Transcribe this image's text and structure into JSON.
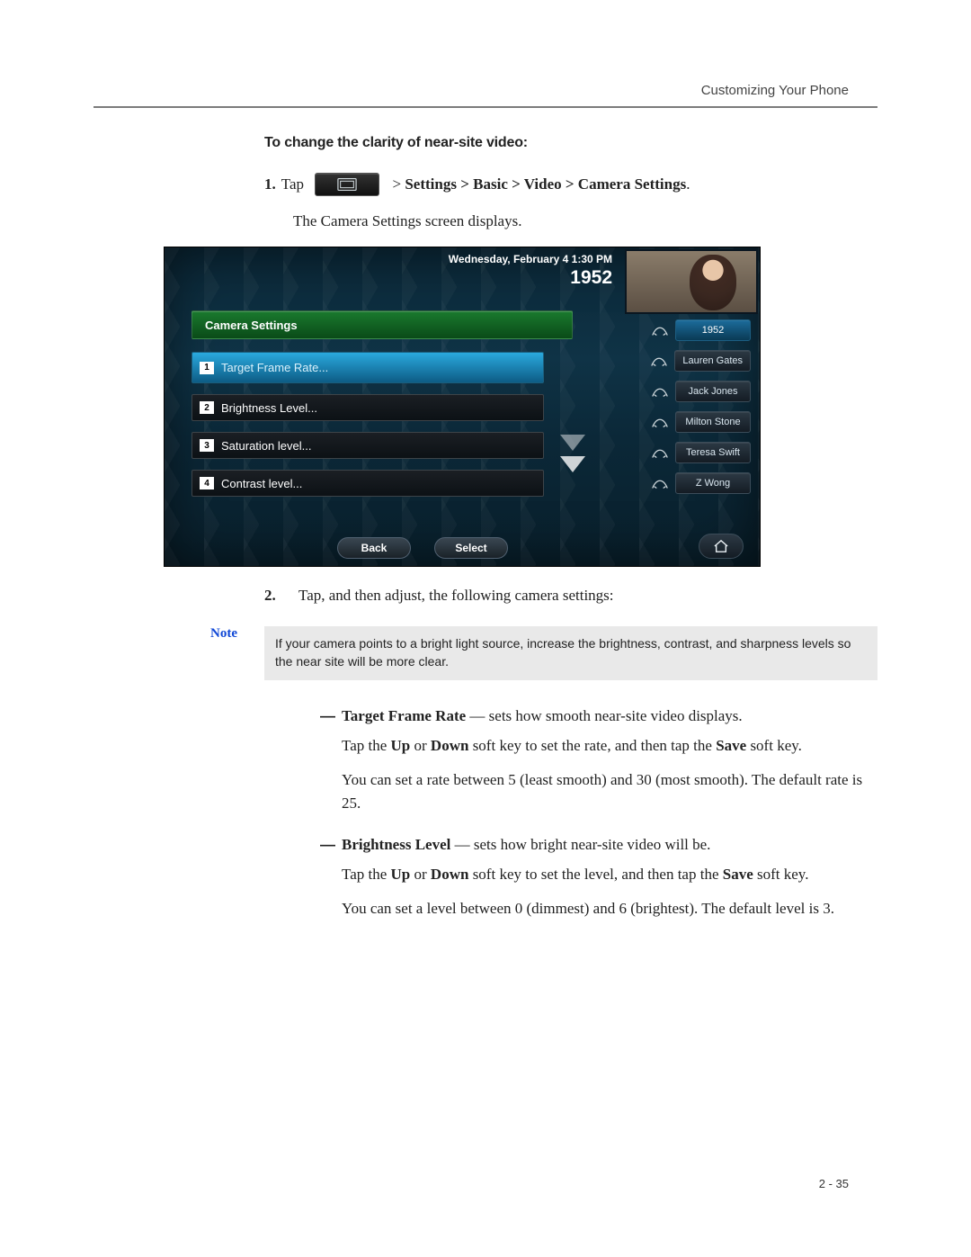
{
  "header": {
    "section": "Customizing Your Phone"
  },
  "subhead": "To change the clarity of near-site video:",
  "step1": {
    "num": "1.",
    "pre": "Tap",
    "path_prefix": "  > ",
    "path": "Settings > Basic > Video > Camera Settings",
    "suffix": ".",
    "desc": "The Camera Settings screen displays."
  },
  "phone": {
    "date": "Wednesday, February 4  1:30 PM",
    "ext": "1952",
    "screen_title": "Camera Settings",
    "menu": [
      {
        "num": "1",
        "label": "Target Frame Rate...",
        "active": true
      },
      {
        "num": "2",
        "label": "Brightness Level...",
        "active": false
      },
      {
        "num": "3",
        "label": "Saturation level...",
        "active": false
      },
      {
        "num": "4",
        "label": "Contrast level...",
        "active": false
      }
    ],
    "contacts": [
      {
        "label": "1952",
        "active": true
      },
      {
        "label": "Lauren Gates",
        "active": false
      },
      {
        "label": "Jack Jones",
        "active": false
      },
      {
        "label": "Milton Stone",
        "active": false
      },
      {
        "label": "Teresa Swift",
        "active": false
      },
      {
        "label": "Z Wong",
        "active": false
      }
    ],
    "softkeys": {
      "back": "Back",
      "select": "Select"
    }
  },
  "step2": {
    "num": "2.",
    "text": "Tap, and then adjust, the following camera settings:"
  },
  "note": {
    "label": "Note",
    "body": "If your camera points to a bright light source, increase the brightness, contrast, and sharpness levels so the near site will be more clear."
  },
  "bullets": [
    {
      "title": "Target Frame Rate",
      "title_sep": "—",
      "title_rest": "sets how smooth near-site video displays.",
      "p1_a": "Tap the ",
      "p1_b1": "Up",
      "p1_mid": " or ",
      "p1_b2": "Down",
      "p1_c": " soft key to set the rate, and then tap the ",
      "p1_b3": "Save",
      "p1_d": " soft key.",
      "p2": "You can set a rate between 5 (least smooth) and 30 (most smooth). The default rate is 25."
    },
    {
      "title": "Brightness Level",
      "title_sep": "—",
      "title_rest": "sets how bright near-site video will be.",
      "p1_a": "Tap the ",
      "p1_b1": "Up",
      "p1_mid": " or ",
      "p1_b2": "Down",
      "p1_c": " soft key to set the level, and then tap the ",
      "p1_b3": "Save",
      "p1_d": " soft key.",
      "p2": "You can set a level between 0 (dimmest) and 6 (brightest). The default level is 3."
    }
  ],
  "page_num": "2 - 35"
}
